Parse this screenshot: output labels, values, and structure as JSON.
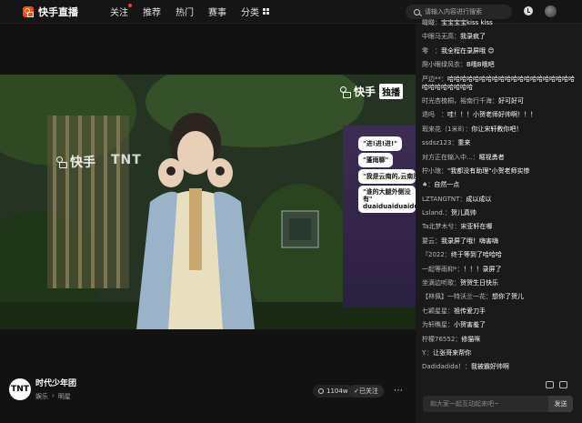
{
  "header": {
    "logo_text": "快手直播",
    "nav": [
      {
        "label": "关注",
        "has_dot": true
      },
      {
        "label": "推荐"
      },
      {
        "label": "热门"
      },
      {
        "label": "赛事"
      },
      {
        "label": "分类"
      }
    ],
    "search_placeholder": "请输入内容进行搜索"
  },
  "video": {
    "watermark_logo": "快手",
    "watermark_badge": "独播",
    "backdrop_logo": "快手",
    "backdrop_text": "TNT",
    "bubbles": [
      "\"进!进!进!\"",
      "\"蓬雨聊\"",
      "\"我是云南的,云南那\"",
      "\"谁的大腿外侧没有\" duaiduaiduaiduai"
    ]
  },
  "streamer": {
    "logo": "TNT",
    "name": "时代少年团",
    "tags": [
      "娱乐",
      "明星"
    ],
    "viewers": "1104w",
    "follow_label": "已关注",
    "more_icon": "more-icon"
  },
  "chat": {
    "messages": [
      {
        "user": "瞰瞰：",
        "text": "宝宝宝宝kiss kiss"
      },
      {
        "user": "中眼马无高：",
        "text": "我录疯了"
      },
      {
        "user": "零　：",
        "text": "我全程在录屏哦 😊"
      },
      {
        "user": "爬小眼绿风衣：",
        "text": "B哦B哦吧"
      },
      {
        "user": "严边**：",
        "text": "哈哈哈哈哈哈哈哈哈哈哈哈哈哈哈哈哈哈哈哈哈哈哈哈哈哈哈哈"
      },
      {
        "user": "时光杏梳桐，裕南行千海：",
        "text": "好可好可"
      },
      {
        "user": "退吗　：",
        "text": "哇！！！小贺老师好帅啊！！！"
      },
      {
        "user": "瑕来花（1米8）：",
        "text": "你让宋轩教你吧！"
      },
      {
        "user": "ssdsz123：",
        "text": "重来"
      },
      {
        "user": "对方正在输入中...：",
        "text": "暱视勇者"
      },
      {
        "user": "柠小琅：",
        "text": "\"我都没有助理\"小贺老师实惨"
      },
      {
        "user": "♠：",
        "text": "自然一点"
      },
      {
        "user": "LZTANGTNT：",
        "text": "成以成以"
      },
      {
        "user": "Lsland.：",
        "text": "贺儿真帅"
      },
      {
        "user": "Ta北梦木兮：",
        "text": "宋亚轩在哪"
      },
      {
        "user": "要云：",
        "text": "我录屏了哦！嗨害嗨"
      },
      {
        "user": "『2022：",
        "text": "终于等到了哈哈哈"
      },
      {
        "user": "一起等雨抑*：",
        "text": "！！！录屏了"
      },
      {
        "user": "坐滴边听歌：",
        "text": "贺贺生日快乐"
      },
      {
        "user": "【林佩】一特沃兰一花：",
        "text": "想你了贺儿"
      },
      {
        "user": "七颖星星：",
        "text": "祖传爱刀手"
      },
      {
        "user": "为轩瞧星：",
        "text": "小贺害羞了"
      },
      {
        "user": "柠檬76552：",
        "text": "修猫咪"
      },
      {
        "user": "Y.：",
        "text": "让张哥来帮你"
      },
      {
        "user": "Dadidadida！：",
        "text": "我被霸好帅啊"
      }
    ],
    "input_placeholder": "和大家一起互动起来吧~",
    "send_label": "发送"
  }
}
